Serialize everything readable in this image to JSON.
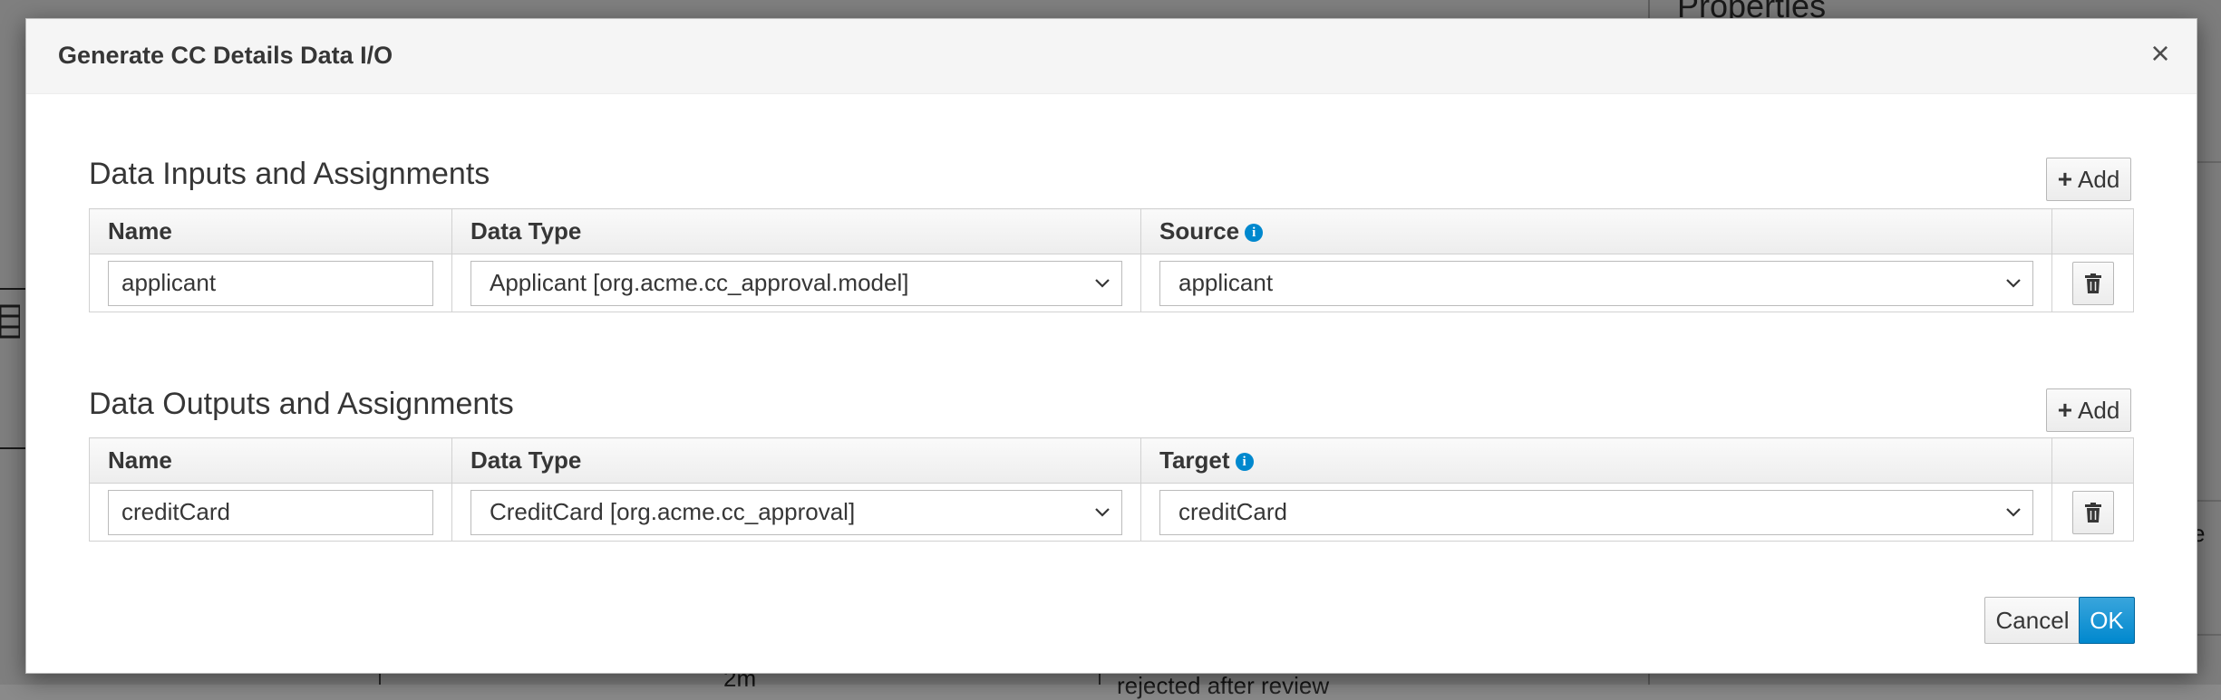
{
  "background": {
    "panel_title": "Properties",
    "duration_text": "2m",
    "status_text": "rejected after review",
    "clipped_letter": "e"
  },
  "modal": {
    "title": "Generate CC Details Data I/O",
    "close_label": "×"
  },
  "inputs": {
    "section_title": "Data Inputs and Assignments",
    "add_label": "Add",
    "headers": {
      "name": "Name",
      "data_type": "Data Type",
      "source": "Source"
    },
    "rows": [
      {
        "name": "applicant",
        "data_type": "Applicant [org.acme.cc_approval.model]",
        "source": "applicant"
      }
    ]
  },
  "outputs": {
    "section_title": "Data Outputs and Assignments",
    "add_label": "Add",
    "headers": {
      "name": "Name",
      "data_type": "Data Type",
      "target": "Target"
    },
    "rows": [
      {
        "name": "creditCard",
        "data_type": "CreditCard [org.acme.cc_approval]",
        "target": "creditCard"
      }
    ]
  },
  "footer": {
    "cancel_label": "Cancel",
    "ok_label": "OK"
  },
  "colors": {
    "primary": "#0088ce",
    "header_bg": "#f5f5f5",
    "border": "#d1d1d1"
  },
  "icons": {
    "close": "close-icon",
    "add": "plus-icon",
    "info": "info-icon",
    "dropdown": "chevron-down-icon",
    "delete": "trash-icon"
  }
}
